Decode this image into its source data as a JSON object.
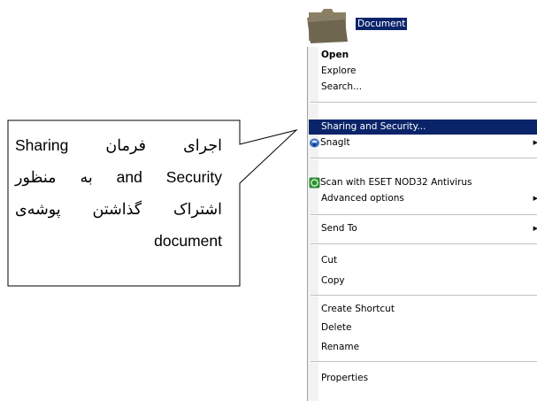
{
  "folder": {
    "label": "Document",
    "icon": "folder-icon"
  },
  "menu": {
    "items": [
      {
        "label": "Open",
        "bold": true
      },
      {
        "label": "Explore"
      },
      {
        "label": "Search..."
      },
      {
        "label": "Sharing and Security...",
        "highlighted": true
      },
      {
        "label": "SnagIt",
        "icon": "snagit-icon",
        "submenu": true
      },
      {
        "label": "Scan with ESET NOD32 Antivirus",
        "icon": "eset-icon"
      },
      {
        "label": "Advanced options",
        "submenu": true
      },
      {
        "label": "Send To",
        "submenu": true
      },
      {
        "label": "Cut"
      },
      {
        "label": "Copy"
      },
      {
        "label": "Create Shortcut"
      },
      {
        "label": "Delete"
      },
      {
        "label": "Rename"
      },
      {
        "label": "Properties"
      }
    ],
    "submenu_arrow": "▶"
  },
  "callout": {
    "lines": [
      "اجرای فرمان Sharing",
      "and Security به منظور",
      "اشتراک گذاشتن پوشه‌ی",
      "document"
    ]
  },
  "colors": {
    "selection": "#0a246a",
    "menu_border": "#a0a0a0",
    "folder": "#7a6f55"
  }
}
